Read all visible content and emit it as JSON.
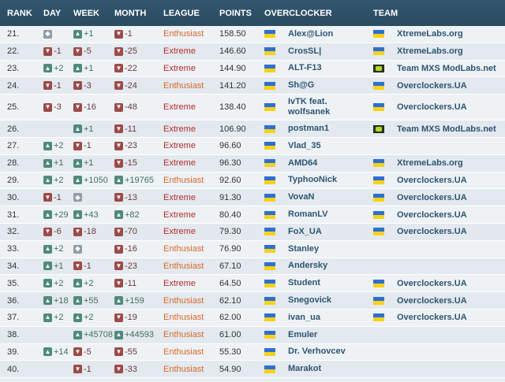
{
  "columns": [
    "RANK",
    "DAY",
    "WEEK",
    "MONTH",
    "LEAGUE",
    "POINTS",
    "OVERCLOCKER",
    "TEAM"
  ],
  "colors": {
    "header_bg": "#2a4b60",
    "extreme": "#b62c2c",
    "enthusiast": "#d9692b",
    "link": "#2d5573",
    "up": "#4f8a7a",
    "down": "#9c4a4a",
    "same": "#8e9ca6"
  },
  "rows": [
    {
      "rank": "21.",
      "day": {
        "dir": "same",
        "val": ""
      },
      "week": {
        "dir": "up",
        "val": "+1"
      },
      "month": {
        "dir": "down",
        "val": "-1"
      },
      "league": "Enthusiast",
      "points": "158.50",
      "oc_flag": "ua",
      "name": "Alex@Lion",
      "team_flag": "ua",
      "team": "XtremeLabs.org"
    },
    {
      "rank": "22.",
      "day": {
        "dir": "down",
        "val": "-1"
      },
      "week": {
        "dir": "down",
        "val": "-5"
      },
      "month": {
        "dir": "down",
        "val": "-25"
      },
      "league": "Extreme",
      "points": "146.60",
      "oc_flag": "ua",
      "name": "CrosSL|",
      "team_flag": "ua",
      "team": "XtremeLabs.org"
    },
    {
      "rank": "23.",
      "day": {
        "dir": "up",
        "val": "+2"
      },
      "week": {
        "dir": "up",
        "val": "+1"
      },
      "month": {
        "dir": "down",
        "val": "-22"
      },
      "league": "Extreme",
      "points": "144.90",
      "oc_flag": "ua",
      "name": "ALT-F13",
      "team_flag": "mxs",
      "team": "Team MXS ModLabs.net"
    },
    {
      "rank": "24.",
      "day": {
        "dir": "down",
        "val": "-1"
      },
      "week": {
        "dir": "down",
        "val": "-3"
      },
      "month": {
        "dir": "down",
        "val": "-24"
      },
      "league": "Enthusiast",
      "points": "141.20",
      "oc_flag": "ua",
      "name": "Sh@G",
      "team_flag": "ua",
      "team": "Overclockers.UA"
    },
    {
      "rank": "25.",
      "day": {
        "dir": "down",
        "val": "-3"
      },
      "week": {
        "dir": "down",
        "val": "-16"
      },
      "month": {
        "dir": "down",
        "val": "-48"
      },
      "league": "Extreme",
      "points": "138.40",
      "oc_flag": "ua",
      "name": "IvTK feat. wolfsanek",
      "team_flag": "ua",
      "team": "Overclockers.UA",
      "tall": true
    },
    {
      "rank": "26.",
      "day": {
        "dir": "none",
        "val": ""
      },
      "week": {
        "dir": "up",
        "val": "+1"
      },
      "month": {
        "dir": "down",
        "val": "-11"
      },
      "league": "Extreme",
      "points": "106.90",
      "oc_flag": "ua",
      "name": "postman1",
      "team_flag": "mxs",
      "team": "Team MXS ModLabs.net"
    },
    {
      "rank": "27.",
      "day": {
        "dir": "up",
        "val": "+2"
      },
      "week": {
        "dir": "down",
        "val": "-1"
      },
      "month": {
        "dir": "down",
        "val": "-23"
      },
      "league": "Extreme",
      "points": "96.60",
      "oc_flag": "ua",
      "name": "Vlad_35",
      "team_flag": "none",
      "team": ""
    },
    {
      "rank": "28.",
      "day": {
        "dir": "up",
        "val": "+1"
      },
      "week": {
        "dir": "up",
        "val": "+1"
      },
      "month": {
        "dir": "down",
        "val": "-15"
      },
      "league": "Extreme",
      "points": "96.30",
      "oc_flag": "ua",
      "name": "AMD64",
      "team_flag": "ua",
      "team": "XtremeLabs.org"
    },
    {
      "rank": "29.",
      "day": {
        "dir": "up",
        "val": "+2"
      },
      "week": {
        "dir": "up",
        "val": "+1050"
      },
      "month": {
        "dir": "up",
        "val": "+19765"
      },
      "league": "Enthusiast",
      "points": "92.60",
      "oc_flag": "ua",
      "name": "TyphooNick",
      "team_flag": "ua",
      "team": "Overclockers.UA"
    },
    {
      "rank": "30.",
      "day": {
        "dir": "down",
        "val": "-1"
      },
      "week": {
        "dir": "same",
        "val": ""
      },
      "month": {
        "dir": "down",
        "val": "-13"
      },
      "league": "Extreme",
      "points": "91.30",
      "oc_flag": "ua",
      "name": "VovaN",
      "team_flag": "ua",
      "team": "Overclockers.UA"
    },
    {
      "rank": "31.",
      "day": {
        "dir": "up",
        "val": "+29"
      },
      "week": {
        "dir": "up",
        "val": "+43"
      },
      "month": {
        "dir": "up",
        "val": "+82"
      },
      "league": "Extreme",
      "points": "80.40",
      "oc_flag": "ua",
      "name": "RomanLV",
      "team_flag": "ua",
      "team": "Overclockers.UA"
    },
    {
      "rank": "32.",
      "day": {
        "dir": "down",
        "val": "-6"
      },
      "week": {
        "dir": "down",
        "val": "-18"
      },
      "month": {
        "dir": "down",
        "val": "-70"
      },
      "league": "Extreme",
      "points": "79.30",
      "oc_flag": "ua",
      "name": "FoX_UA",
      "team_flag": "ua",
      "team": "Overclockers.UA"
    },
    {
      "rank": "33.",
      "day": {
        "dir": "up",
        "val": "+2"
      },
      "week": {
        "dir": "same",
        "val": ""
      },
      "month": {
        "dir": "down",
        "val": "-16"
      },
      "league": "Enthusiast",
      "points": "76.90",
      "oc_flag": "ua",
      "name": "Stanley",
      "team_flag": "none",
      "team": ""
    },
    {
      "rank": "34.",
      "day": {
        "dir": "up",
        "val": "+1"
      },
      "week": {
        "dir": "down",
        "val": "-1"
      },
      "month": {
        "dir": "down",
        "val": "-23"
      },
      "league": "Enthusiast",
      "points": "67.10",
      "oc_flag": "ua",
      "name": "Andersky",
      "team_flag": "none",
      "team": ""
    },
    {
      "rank": "35.",
      "day": {
        "dir": "up",
        "val": "+2"
      },
      "week": {
        "dir": "up",
        "val": "+2"
      },
      "month": {
        "dir": "down",
        "val": "-11"
      },
      "league": "Extreme",
      "points": "64.50",
      "oc_flag": "ua",
      "name": "Student",
      "team_flag": "ua",
      "team": "Overclockers.UA"
    },
    {
      "rank": "36.",
      "day": {
        "dir": "up",
        "val": "+18"
      },
      "week": {
        "dir": "up",
        "val": "+55"
      },
      "month": {
        "dir": "up",
        "val": "+159"
      },
      "league": "Enthusiast",
      "points": "62.10",
      "oc_flag": "ua",
      "name": "Snegovick",
      "team_flag": "ua",
      "team": "Overclockers.UA"
    },
    {
      "rank": "37.",
      "day": {
        "dir": "up",
        "val": "+2"
      },
      "week": {
        "dir": "up",
        "val": "+2"
      },
      "month": {
        "dir": "down",
        "val": "-19"
      },
      "league": "Enthusiast",
      "points": "62.00",
      "oc_flag": "ua",
      "name": "ivan_ua",
      "team_flag": "ua",
      "team": "Overclockers.UA"
    },
    {
      "rank": "38.",
      "day": {
        "dir": "none",
        "val": ""
      },
      "week": {
        "dir": "up",
        "val": "+45708"
      },
      "month": {
        "dir": "up",
        "val": "+44593"
      },
      "league": "Enthusiast",
      "points": "61.00",
      "oc_flag": "ua",
      "name": "Emuler",
      "team_flag": "none",
      "team": ""
    },
    {
      "rank": "39.",
      "day": {
        "dir": "up",
        "val": "+14"
      },
      "week": {
        "dir": "down",
        "val": "-5"
      },
      "month": {
        "dir": "down",
        "val": "-55"
      },
      "league": "Enthusiast",
      "points": "55.30",
      "oc_flag": "ua",
      "name": "Dr. Verhovcev",
      "team_flag": "none",
      "team": ""
    },
    {
      "rank": "40.",
      "day": {
        "dir": "none",
        "val": ""
      },
      "week": {
        "dir": "down",
        "val": "-1"
      },
      "month": {
        "dir": "down",
        "val": "-33"
      },
      "league": "Enthusiast",
      "points": "54.90",
      "oc_flag": "ua",
      "name": "Marakot",
      "team_flag": "none",
      "team": ""
    }
  ]
}
